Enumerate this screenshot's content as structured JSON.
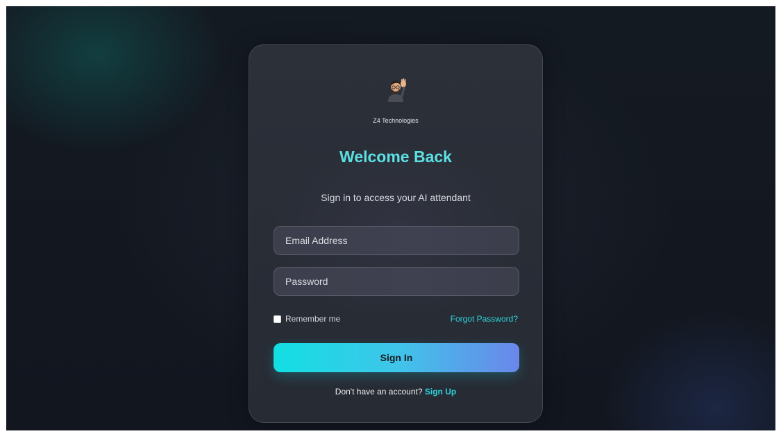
{
  "brand": {
    "logo_icon": "waving-memoji-avatar",
    "name": "Z4 Technologies"
  },
  "header": {
    "title": "Welcome Back",
    "subtitle": "Sign in to access your AI attendant"
  },
  "form": {
    "email_placeholder": "Email Address",
    "email_value": "",
    "password_placeholder": "Password",
    "password_value": "",
    "remember_label": "Remember me",
    "remember_checked": false,
    "forgot_label": "Forgot Password?",
    "submit_label": "Sign In"
  },
  "footer": {
    "prompt": "Don't have an account?",
    "signup_label": "Sign Up"
  },
  "colors": {
    "accent": "#2ed3da",
    "title": "#5ce0e4",
    "button_gradient_start": "#12dfe2",
    "button_gradient_end": "#6a87ea",
    "card": "#2c3039",
    "background": "#141a22"
  }
}
